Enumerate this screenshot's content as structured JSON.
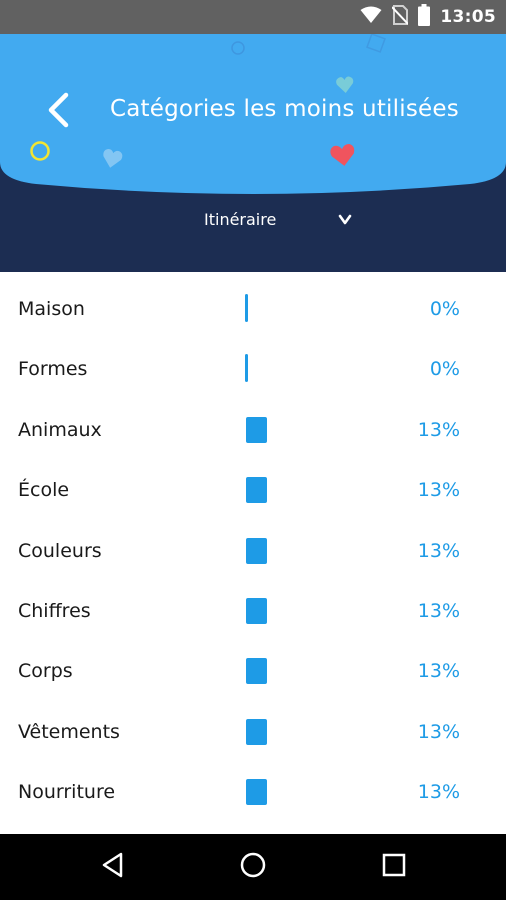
{
  "status_bar": {
    "time": "13:05",
    "icons": [
      "wifi-icon",
      "no-sim-icon",
      "battery-icon"
    ]
  },
  "header": {
    "title": "Catégories les moins utilisées",
    "back_icon": "chevron-left-icon",
    "filter": {
      "selected": "Itinéraire",
      "icon": "chevron-down-icon"
    }
  },
  "colors": {
    "status_bar": "#616161",
    "header_light": "#42aaf0",
    "header_dark": "#1c2d52",
    "accent": "#1e9be6",
    "heart": "#f0545e",
    "ring": "#f2e533"
  },
  "categories": [
    {
      "name": "Maison",
      "percent_label": "0%",
      "value": 0
    },
    {
      "name": "Formes",
      "percent_label": "0%",
      "value": 0
    },
    {
      "name": "Animaux",
      "percent_label": "13%",
      "value": 13
    },
    {
      "name": "École",
      "percent_label": "13%",
      "value": 13
    },
    {
      "name": "Couleurs",
      "percent_label": "13%",
      "value": 13
    },
    {
      "name": "Chiffres",
      "percent_label": "13%",
      "value": 13
    },
    {
      "name": "Corps",
      "percent_label": "13%",
      "value": 13
    },
    {
      "name": "Vêtements",
      "percent_label": "13%",
      "value": 13
    },
    {
      "name": "Nourriture",
      "percent_label": "13%",
      "value": 13
    }
  ],
  "nav_bar": {
    "buttons": [
      "back-triangle-icon",
      "home-circle-icon",
      "recents-square-icon"
    ]
  }
}
